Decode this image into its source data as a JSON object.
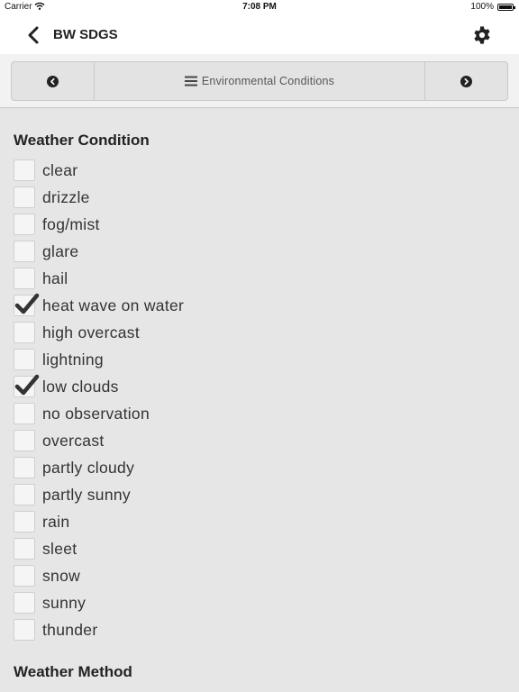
{
  "status": {
    "carrier": "Carrier",
    "time": "7:08 PM",
    "battery": "100%"
  },
  "nav": {
    "title": "BW SDGS"
  },
  "section_nav": {
    "current_label": "Environmental Conditions"
  },
  "weather_condition": {
    "heading": "Weather Condition",
    "options": [
      {
        "label": "clear",
        "checked": false
      },
      {
        "label": "drizzle",
        "checked": false
      },
      {
        "label": "fog/mist",
        "checked": false
      },
      {
        "label": "glare",
        "checked": false
      },
      {
        "label": "hail",
        "checked": false
      },
      {
        "label": "heat wave on water",
        "checked": true
      },
      {
        "label": "high overcast",
        "checked": false
      },
      {
        "label": "lightning",
        "checked": false
      },
      {
        "label": "low clouds",
        "checked": true
      },
      {
        "label": "no observation",
        "checked": false
      },
      {
        "label": "overcast",
        "checked": false
      },
      {
        "label": "partly cloudy",
        "checked": false
      },
      {
        "label": "partly sunny",
        "checked": false
      },
      {
        "label": "rain",
        "checked": false
      },
      {
        "label": "sleet",
        "checked": false
      },
      {
        "label": "snow",
        "checked": false
      },
      {
        "label": "sunny",
        "checked": false
      },
      {
        "label": "thunder",
        "checked": false
      }
    ]
  },
  "weather_method": {
    "heading": "Weather Method"
  }
}
